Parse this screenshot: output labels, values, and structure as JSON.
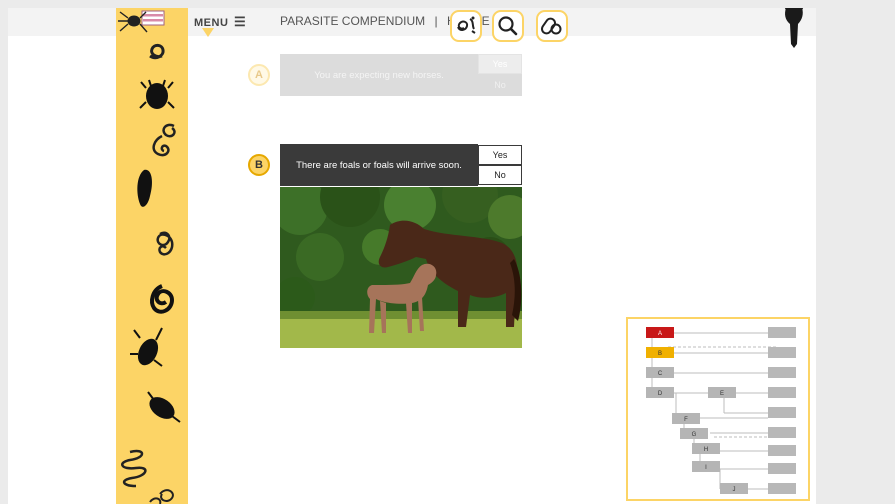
{
  "header": {
    "menu_label": "MENU",
    "title": "PARASITE COMPENDIUM",
    "separator": "|",
    "section": "HORSE"
  },
  "toolbar": {
    "buttons": [
      {
        "icon": "parasite-lifecycle-icon"
      },
      {
        "icon": "search-icon"
      },
      {
        "icon": "pills-icon"
      }
    ]
  },
  "sidebar": {
    "icons": [
      "flag-icon",
      "spider-icon",
      "coiled-worm-icon",
      "tick-icon",
      "curled-larva-icon",
      "fly-larva-icon",
      "spiral-worm-icon",
      "spiral-worm-icon",
      "mite-icon",
      "beetle-icon",
      "louse-icon",
      "tangled-worm-icon",
      "spiral-worm-icon"
    ]
  },
  "questions": [
    {
      "letter": "A",
      "text": "You are expecting new horses.",
      "yes": "Yes",
      "no": "No",
      "state": "inactive"
    },
    {
      "letter": "B",
      "text": "There are foals or foals will arrive soon.",
      "yes": "Yes",
      "no": "No",
      "state": "active"
    }
  ],
  "photo": {
    "subject": "mare and foal on grass"
  },
  "flowchart": {
    "nodes": [
      "A",
      "B",
      "C",
      "D",
      "E",
      "F",
      "G",
      "H",
      "I",
      "J"
    ],
    "current": "A",
    "active": "B"
  },
  "colors": {
    "accent": "#fcd466",
    "dark_bar": "#3a3a3a",
    "node_current": "#c81818",
    "node_active": "#f0b000",
    "node_default": "#b5b5b5"
  }
}
